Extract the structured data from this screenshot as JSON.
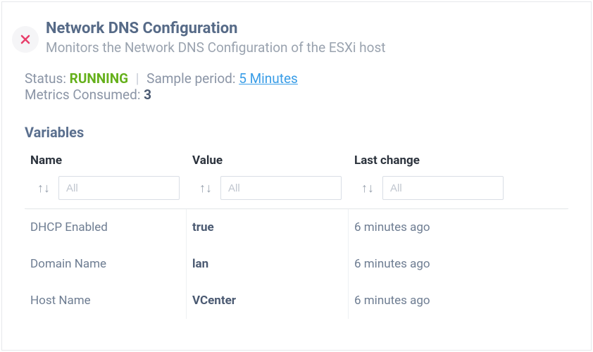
{
  "header": {
    "title": "Network DNS Configuration",
    "subtitle": "Monitors the Network DNS Configuration of the ESXi host"
  },
  "meta": {
    "status_label": "Status:",
    "status_value": "RUNNING",
    "sample_label": "Sample period:",
    "sample_value": "5 Minutes",
    "metrics_label": "Metrics Consumed:",
    "metrics_value": "3"
  },
  "section_title": "Variables",
  "columns": {
    "name": "Name",
    "value": "Value",
    "last": "Last change",
    "filter_placeholder": "All"
  },
  "rows": [
    {
      "name": "DHCP Enabled",
      "value": "true",
      "last": "6 minutes ago"
    },
    {
      "name": "Domain Name",
      "value": "lan",
      "last": "6 minutes ago"
    },
    {
      "name": "Host Name",
      "value": "VCenter",
      "last": "6 minutes ago"
    }
  ]
}
